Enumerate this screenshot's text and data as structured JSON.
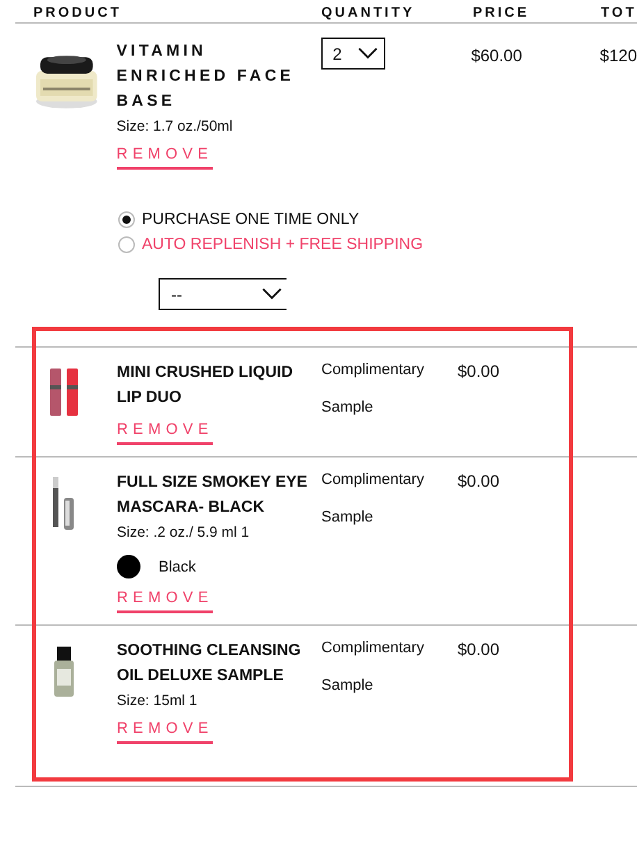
{
  "columns": [
    "PRODUCT",
    "QUANTITY",
    "PRICE",
    "TOT"
  ],
  "item": {
    "name": "VITAMIN ENRICHED FACE BASE",
    "size": "Size: 1.7 oz./50ml",
    "remove": "REMOVE",
    "quantity": "2",
    "price": "$60.00",
    "total": "$120",
    "purchase_options": [
      {
        "label": "PURCHASE ONE TIME ONLY",
        "selected": true
      },
      {
        "label": "AUTO REPLENISH + FREE SHIPPING",
        "selected": false
      }
    ],
    "replenish_interval": "--"
  },
  "samples_highlighted": true,
  "samples": [
    {
      "name": "MINI CRUSHED LIQUID LIP DUO",
      "status": "Complimentary Sample",
      "price": "$0.00",
      "remove": "REMOVE"
    },
    {
      "name": "FULL SIZE SMOKEY EYE MASCARA- BLACK",
      "size": "Size: .2 oz./ 5.9 ml 1",
      "shade": {
        "name": "Black",
        "color": "#000000"
      },
      "status": "Complimentary Sample",
      "price": "$0.00",
      "remove": "REMOVE"
    },
    {
      "name": "SOOTHING CLEANSING OIL DELUXE SAMPLE",
      "size": "Size: 15ml 1",
      "status": "Complimentary Sample",
      "price": "$0.00",
      "remove": "REMOVE"
    }
  ]
}
